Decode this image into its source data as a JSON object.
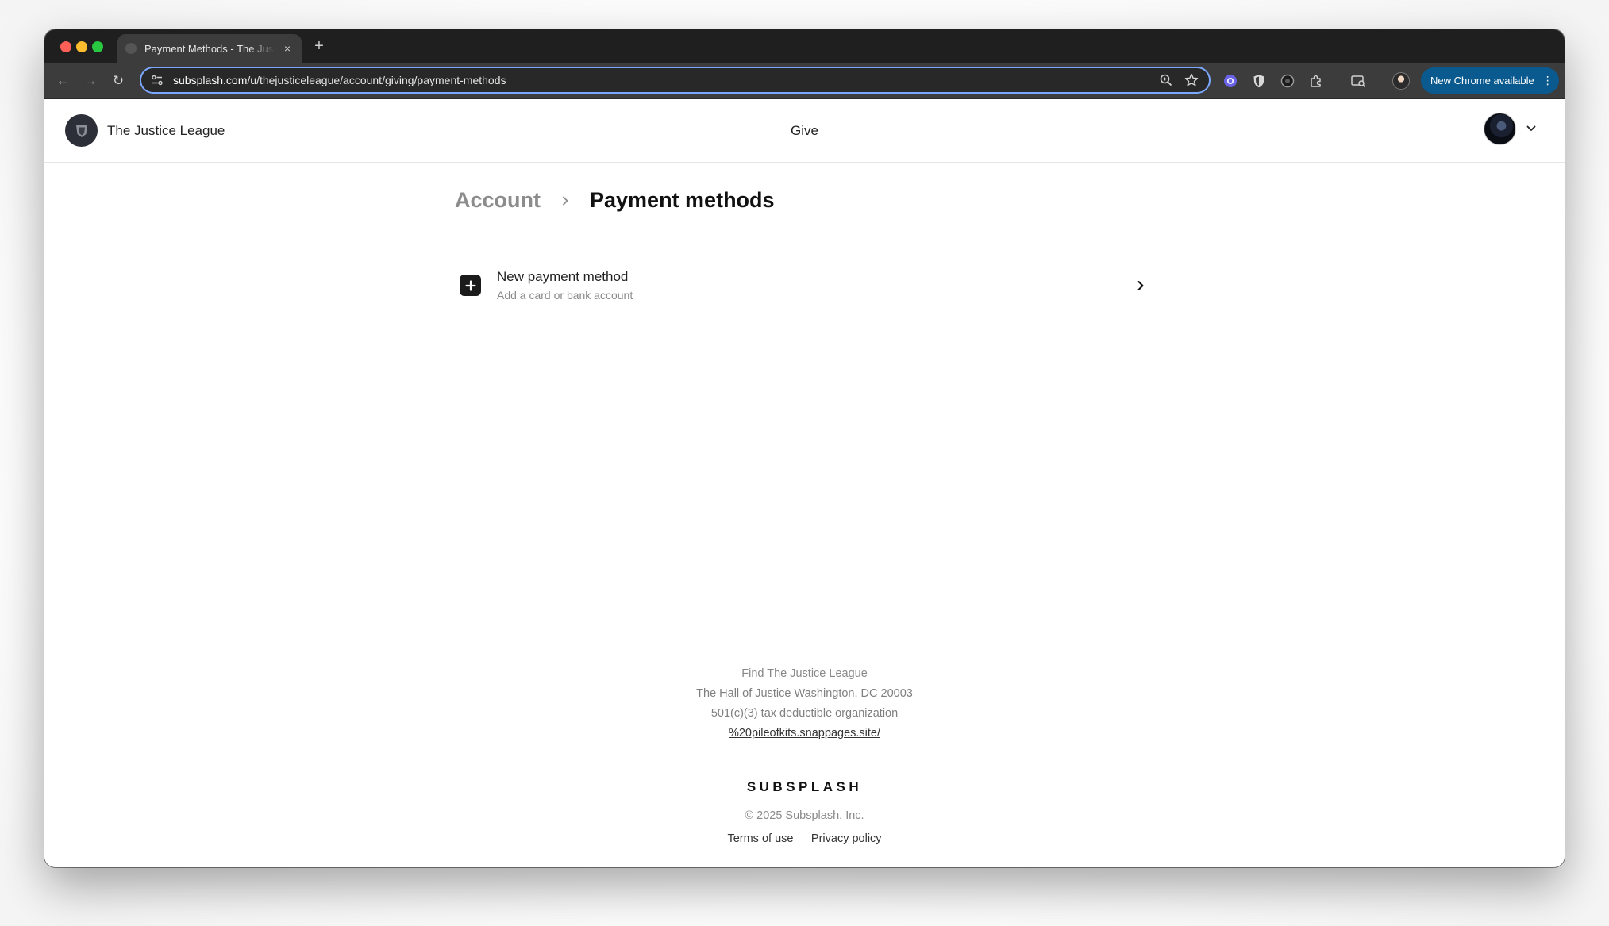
{
  "browser": {
    "tab_title": "Payment Methods - The Justice League",
    "tab_close": "×",
    "new_tab": "+",
    "url_host": "subsplash.com",
    "url_path": "/u/thejusticeleague/account/giving/payment-methods",
    "update_button": "New Chrome available",
    "menu_dots": "⋮",
    "nav": {
      "back": "←",
      "forward": "→",
      "reload": "↻"
    }
  },
  "header": {
    "org_name": "The Justice League",
    "nav_give": "Give"
  },
  "breadcrumb": {
    "parent": "Account",
    "current": "Payment methods"
  },
  "payment_methods": {
    "new_title": "New payment method",
    "new_subtitle": "Add a card or bank account"
  },
  "footer": {
    "find": "Find The Justice League",
    "address": "The Hall of Justice Washington, DC 20003",
    "tax": "501(c)(3) tax deductible organization",
    "website": "%20pileofkits.snappages.site/",
    "brand": "SUBSPLASH",
    "copyright": "© 2025 Subsplash, Inc.",
    "terms": "Terms of use",
    "privacy": "Privacy policy"
  },
  "colors": {
    "omnibox_focus": "#7ca7ff",
    "update_button_bg": "#0b5a8f",
    "breadcrumb_muted": "#8c8c8c"
  }
}
